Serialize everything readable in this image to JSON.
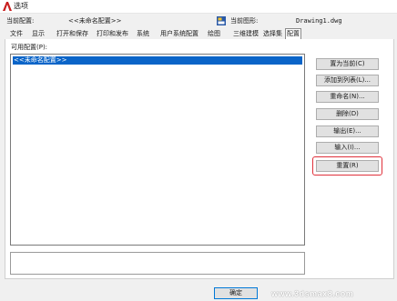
{
  "window": {
    "title": "选项"
  },
  "header": {
    "current_config_label": "当前配置:",
    "current_config_value": "<<未命名配置>>",
    "current_drawing_label": "当前图形:",
    "current_drawing_value": "Drawing1.dwg"
  },
  "tabs": [
    {
      "label": "文件"
    },
    {
      "label": "显示"
    },
    {
      "label": "打开和保存"
    },
    {
      "label": "打印和发布"
    },
    {
      "label": "系统"
    },
    {
      "label": "用户系统配置"
    },
    {
      "label": "绘图"
    },
    {
      "label": "三维建模"
    },
    {
      "label": "选择集"
    },
    {
      "label": "配置",
      "active": true
    }
  ],
  "profiles": {
    "label": "可用配置(P):",
    "items": [
      "<<未命名配置>>"
    ],
    "selected": "<<未命名配置>>"
  },
  "buttons": {
    "set_current": "置为当前(C)",
    "add_to_list": "添加到列表(L)...",
    "rename": "重命名(N)...",
    "delete": "删除(D)",
    "export": "输出(E)...",
    "import": "输入(I)...",
    "reset": "重置(R)"
  },
  "footer": {
    "ok": "确定"
  },
  "watermark": "www.3dsmax8.com",
  "colors": {
    "selection": "#0a64c8",
    "highlight_box": "#e0303a"
  }
}
